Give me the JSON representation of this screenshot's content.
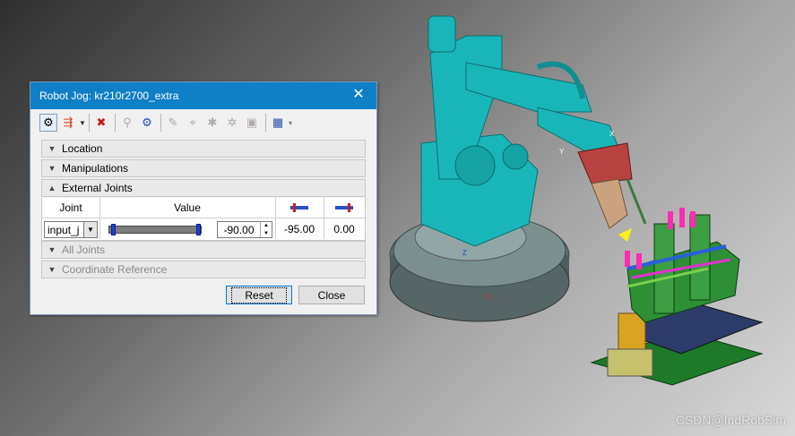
{
  "dialog": {
    "title": "Robot Jog: kr210r2700_extra",
    "close_glyph": "✕"
  },
  "toolbar": {
    "icons": [
      "robot-select-icon",
      "move-arrows-icon",
      "reset-robot-icon",
      "ik-solution-icon",
      "robot-config-icon",
      "teach-point-icon",
      "marker-icon",
      "frame-icon",
      "joint-limits-icon",
      "tcp-icon",
      "settings-icon"
    ]
  },
  "sections": {
    "location": "Location",
    "manipulations": "Manipulations",
    "external_joints": "External Joints",
    "all_joints": "All Joints",
    "coordinate_reference": "Coordinate Reference"
  },
  "table": {
    "col_joint": "Joint",
    "col_value": "Value",
    "joint_select": "input_j",
    "value": "-90.00",
    "lower_limit": "-95.00",
    "upper_limit": "0.00",
    "slider_position_fraction": 0.98
  },
  "buttons": {
    "reset": "Reset",
    "close": "Close"
  },
  "scene": {
    "axis_labels": [
      "Z",
      "X",
      "Y",
      "X"
    ],
    "watermark": "CSDN@IndRobSim"
  },
  "colors": {
    "title_bar": "#0f7fc7",
    "robot": "#19b6b9",
    "fixture_base": "#1d7a28",
    "gripper": "#b8423f"
  }
}
